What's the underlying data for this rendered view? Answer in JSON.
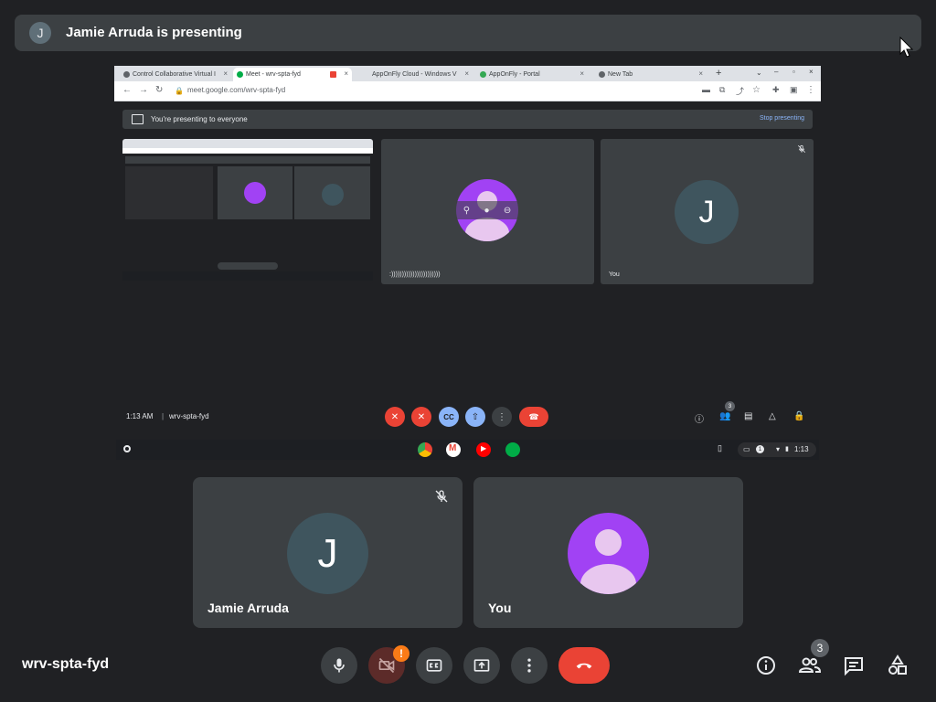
{
  "banner": {
    "avatar_initial": "J",
    "text": "Jamie Arruda is presenting"
  },
  "shared_screen": {
    "tabs": [
      {
        "label": "Control Collaborative Virtual I",
        "color": "#5f6368"
      },
      {
        "label": "Meet - wrv-spta-fyd",
        "color": "#00ac47"
      },
      {
        "label": "AppOnFly Cloud - Windows V",
        "color": "#1a73e8"
      },
      {
        "label": "AppOnFly - Portal",
        "color": "#34a853"
      },
      {
        "label": "New Tab",
        "color": "#5f6368"
      }
    ],
    "url": "meet.google.com/wrv-spta-fyd",
    "presenting_text": "You're presenting to everyone",
    "stop_presenting": "Stop presenting",
    "tiles": [
      {
        "label": ":)))))))))))))))))))))))"
      },
      {
        "label": "You",
        "initial": "J"
      }
    ],
    "time": "1:13 AM",
    "meeting_code": "wrv-spta-fyd",
    "people_count": "3",
    "shelf_status": "1:13",
    "shelf_count": "1"
  },
  "participants": [
    {
      "name": "Jamie Arruda",
      "initial": "J"
    },
    {
      "name": "You"
    }
  ],
  "footer": {
    "meeting_code": "wrv-spta-fyd",
    "people_count": "3",
    "camera_warning": "!"
  },
  "colors": {
    "background": "#202124",
    "tile": "#3c4043",
    "end_call": "#ea4335",
    "avatar_purple": "#a142f4",
    "avatar_slate": "#3f555e"
  }
}
